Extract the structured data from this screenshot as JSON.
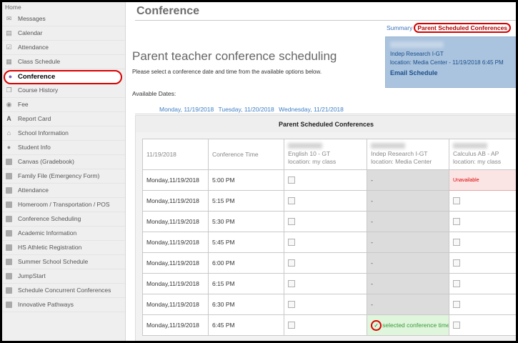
{
  "sidebar": {
    "home": "Home",
    "items": [
      {
        "label": "Messages",
        "icon": "envelope-icon"
      },
      {
        "label": "Calendar",
        "icon": "calendar-icon"
      },
      {
        "label": "Attendance",
        "icon": "checkbox-icon"
      },
      {
        "label": "Class Schedule",
        "icon": "schedule-icon"
      },
      {
        "label": "Conference",
        "icon": "people-icon"
      },
      {
        "label": "Course History",
        "icon": "book-icon"
      },
      {
        "label": "Fee",
        "icon": "coins-icon"
      },
      {
        "label": "Report Card",
        "icon": "grade-icon"
      },
      {
        "label": "School Information",
        "icon": "school-icon"
      },
      {
        "label": "Student Info",
        "icon": "person-icon"
      },
      {
        "label": "Canvas (Gradebook)",
        "icon": "folder-icon"
      },
      {
        "label": "Family File (Emergency Form)",
        "icon": "folder-icon"
      },
      {
        "label": "Attendance",
        "icon": "folder-icon"
      },
      {
        "label": "Homeroom / Transportation / POS",
        "icon": "folder-icon"
      },
      {
        "label": "Conference Scheduling",
        "icon": "folder-icon"
      },
      {
        "label": "Academic Information",
        "icon": "folder-icon"
      },
      {
        "label": "HS Athletic Registration",
        "icon": "folder-icon"
      },
      {
        "label": "Summer School Schedule",
        "icon": "folder-icon"
      },
      {
        "label": "JumpStart",
        "icon": "folder-icon"
      },
      {
        "label": "Schedule Concurrent Conferences",
        "icon": "folder-icon"
      },
      {
        "label": "Innovative Pathways",
        "icon": "folder-icon"
      }
    ]
  },
  "main": {
    "page_title": "Conference",
    "summary_link": "Summary",
    "summary_active": "Parent Scheduled Conferences",
    "info": {
      "line1": "Indep Research I-GT",
      "line2": "location: Media Center - 11/19/2018 6:45 PM",
      "email": "Email Schedule"
    },
    "heading": "Parent teacher conference scheduling",
    "instruction": "Please select a conference date and time from the available options below.",
    "dates_label": "Available Dates:",
    "dates": [
      "Monday, 11/19/2018",
      "Tuesday, 11/20/2018",
      "Wednesday, 11/21/2018"
    ],
    "section_title": "Parent Scheduled Conferences"
  },
  "table": {
    "header_date": "11/19/2018",
    "header_time": "Conference Time",
    "col1": {
      "course": "English 10 - GT",
      "location": "location: my class"
    },
    "col2": {
      "course": "Indep Research I-GT",
      "location": "location: Media Center"
    },
    "col3": {
      "course": "Calculus AB - AP",
      "location": "location: my class"
    },
    "day_label": "Monday,",
    "date_label": "11/19/2018",
    "dash": "-",
    "unavailable": "Unavailable",
    "selected_text": "selected conference time",
    "checkmark": "✓",
    "times": [
      "5:00 PM",
      "5:15 PM",
      "5:30 PM",
      "5:45 PM",
      "6:00 PM",
      "6:15 PM",
      "6:30 PM",
      "6:45 PM"
    ]
  }
}
